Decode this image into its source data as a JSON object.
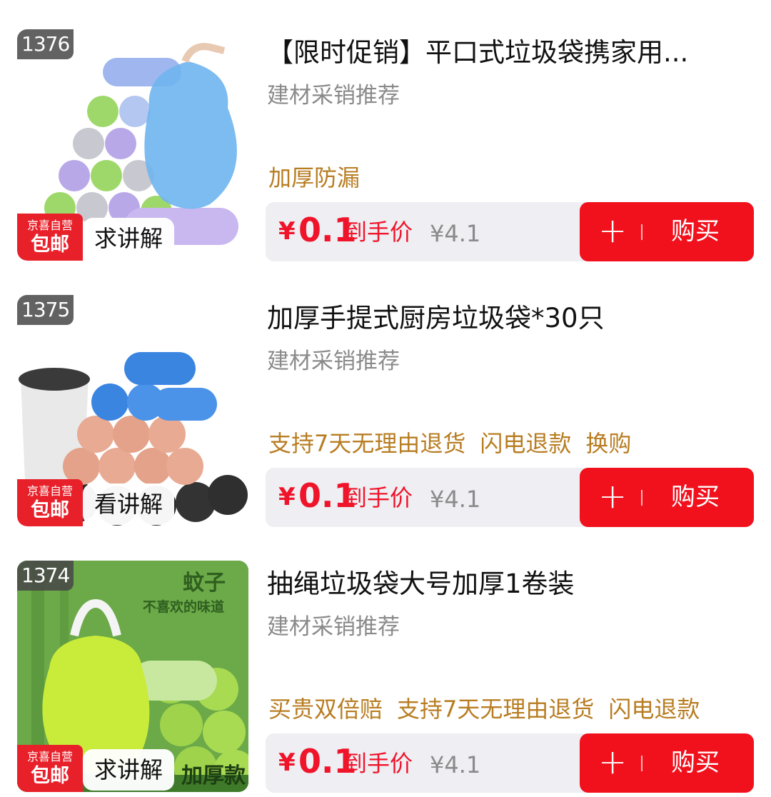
{
  "items": [
    {
      "rank": "1376",
      "badge_top": "京喜自营",
      "badge_bottom": "包邮",
      "explain_label": "求讲解",
      "title": "【限时促销】平口式垃圾袋携家用...",
      "shop": "建材采销推荐",
      "tags": [
        "加厚防漏"
      ],
      "currency": "¥",
      "price": "0.1",
      "price_label": "到手价",
      "original_price": "¥4.1",
      "plus_label": "+",
      "buy_label": "购买"
    },
    {
      "rank": "1375",
      "badge_top": "京喜自营",
      "badge_bottom": "包邮",
      "explain_label": "看讲解",
      "title": "加厚手提式厨房垃圾袋*30只",
      "shop": "建材采销推荐",
      "tags": [
        "支持7天无理由退货",
        "闪电退款",
        "换购"
      ],
      "currency": "¥",
      "price": "0.1",
      "price_label": "到手价",
      "original_price": "¥4.1",
      "plus_label": "+",
      "buy_label": "购买"
    },
    {
      "rank": "1374",
      "badge_top": "京喜自营",
      "badge_bottom": "包邮",
      "explain_label": "求讲解",
      "title": "抽绳垃圾袋大号加厚1卷装",
      "shop": "建材采销推荐",
      "tags": [
        "买贵双倍赔",
        "支持7天无理由退货",
        "闪电退款"
      ],
      "currency": "¥",
      "price": "0.1",
      "price_label": "到手价",
      "original_price": "¥4.1",
      "plus_label": "+",
      "buy_label": "购买",
      "image_text_1": "蚊子",
      "image_text_2": "不喜欢的味道",
      "image_text_3": "加厚款"
    }
  ],
  "colors": {
    "price_red": "#f0142a",
    "button_red": "#f1111d",
    "tag_gold": "#b87d22",
    "badge_red": "#e8202a"
  }
}
